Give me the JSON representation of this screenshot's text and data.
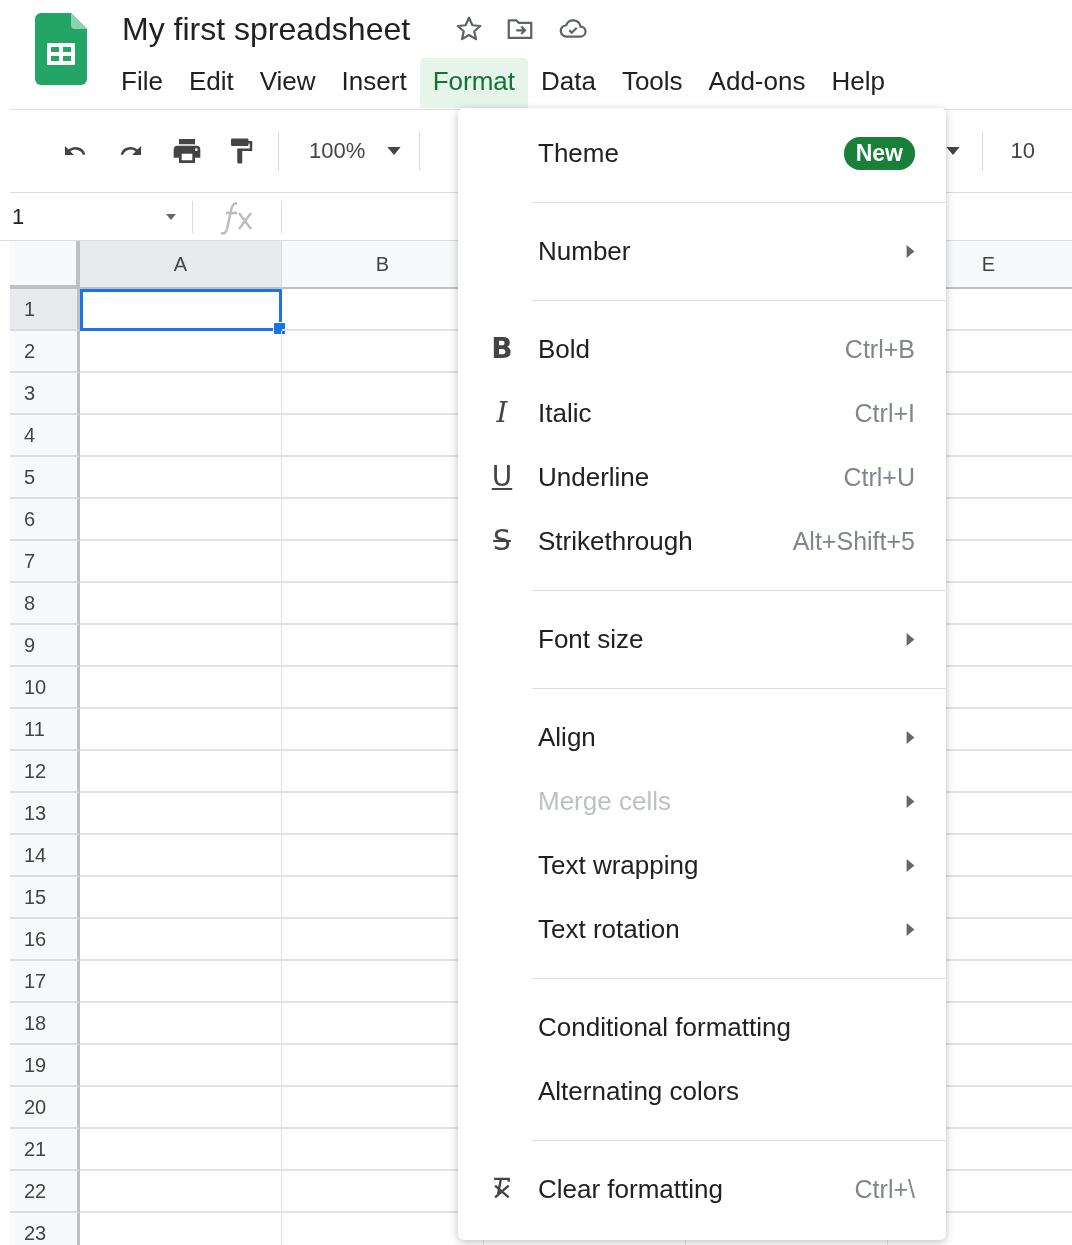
{
  "header": {
    "title": "My first spreadsheet",
    "menu": [
      {
        "label": "File",
        "selected": false
      },
      {
        "label": "Edit",
        "selected": false
      },
      {
        "label": "View",
        "selected": false
      },
      {
        "label": "Insert",
        "selected": false
      },
      {
        "label": "Format",
        "selected": true
      },
      {
        "label": "Data",
        "selected": false
      },
      {
        "label": "Tools",
        "selected": false
      },
      {
        "label": "Add-ons",
        "selected": false
      },
      {
        "label": "Help",
        "selected": false
      }
    ]
  },
  "toolbar": {
    "zoom": "100%",
    "font_size": "10"
  },
  "formula_bar": {
    "name_box": "1"
  },
  "grid": {
    "columns": [
      {
        "label": "A",
        "selected": true
      },
      {
        "label": "B",
        "selected": false
      },
      {
        "label": "E",
        "selected": false
      }
    ],
    "rows": [
      {
        "label": "1",
        "selected": true
      },
      {
        "label": "2",
        "selected": false
      },
      {
        "label": "3",
        "selected": false
      },
      {
        "label": "4",
        "selected": false
      },
      {
        "label": "5",
        "selected": false
      },
      {
        "label": "6",
        "selected": false
      },
      {
        "label": "7",
        "selected": false
      },
      {
        "label": "8",
        "selected": false
      },
      {
        "label": "9",
        "selected": false
      },
      {
        "label": "10",
        "selected": false
      },
      {
        "label": "11",
        "selected": false
      },
      {
        "label": "12",
        "selected": false
      },
      {
        "label": "13",
        "selected": false
      },
      {
        "label": "14",
        "selected": false
      },
      {
        "label": "15",
        "selected": false
      },
      {
        "label": "16",
        "selected": false
      },
      {
        "label": "17",
        "selected": false
      },
      {
        "label": "18",
        "selected": false
      },
      {
        "label": "19",
        "selected": false
      },
      {
        "label": "20",
        "selected": false
      },
      {
        "label": "21",
        "selected": false
      },
      {
        "label": "22",
        "selected": false
      },
      {
        "label": "23",
        "selected": false
      }
    ]
  },
  "format_menu": {
    "items": [
      {
        "kind": "item",
        "label": "Theme",
        "badge": "New",
        "submenu": false,
        "disabled": false
      },
      {
        "kind": "divider"
      },
      {
        "kind": "item",
        "label": "Number",
        "submenu": true,
        "disabled": false
      },
      {
        "kind": "divider"
      },
      {
        "kind": "item",
        "label": "Bold",
        "icon": {
          "kind": "bold",
          "text": "B"
        },
        "shortcut": "Ctrl+B",
        "submenu": false,
        "disabled": false
      },
      {
        "kind": "item",
        "label": "Italic",
        "icon": {
          "kind": "italic",
          "text": "I"
        },
        "shortcut": "Ctrl+I",
        "submenu": false,
        "disabled": false
      },
      {
        "kind": "item",
        "label": "Underline",
        "icon": {
          "kind": "underline",
          "text": "U"
        },
        "shortcut": "Ctrl+U",
        "submenu": false,
        "disabled": false
      },
      {
        "kind": "item",
        "label": "Strikethrough",
        "icon": {
          "kind": "strike",
          "text": "S"
        },
        "shortcut": "Alt+Shift+5",
        "submenu": false,
        "disabled": false
      },
      {
        "kind": "divider"
      },
      {
        "kind": "item",
        "label": "Font size",
        "submenu": true,
        "disabled": false
      },
      {
        "kind": "divider"
      },
      {
        "kind": "item",
        "label": "Align",
        "submenu": true,
        "disabled": false
      },
      {
        "kind": "item",
        "label": "Merge cells",
        "submenu": true,
        "disabled": true
      },
      {
        "kind": "item",
        "label": "Text wrapping",
        "submenu": true,
        "disabled": false
      },
      {
        "kind": "item",
        "label": "Text rotation",
        "submenu": true,
        "disabled": false
      },
      {
        "kind": "divider"
      },
      {
        "kind": "item",
        "label": "Conditional formatting",
        "submenu": false,
        "disabled": false
      },
      {
        "kind": "item",
        "label": "Alternating colors",
        "submenu": false,
        "disabled": false
      },
      {
        "kind": "divider"
      },
      {
        "kind": "item",
        "label": "Clear formatting",
        "icon": {
          "kind": "clear"
        },
        "shortcut": "Ctrl+\\",
        "submenu": false,
        "disabled": false
      }
    ]
  }
}
